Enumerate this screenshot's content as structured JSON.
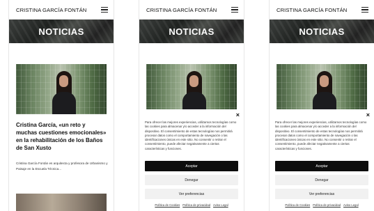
{
  "header": {
    "brand": "CRISTINA GARCÍA FONTÁN"
  },
  "hero": {
    "title": "NOTICIAS"
  },
  "article": {
    "title": "Cristina García, «un reto y muchas cuestiones emocionales» en la rehabilitación de los Baños de San Xusto",
    "excerpt": "Cristina García Fontán es arquitecta y profesora de Urbanismo y Paisaje en la Escuela Técnica..."
  },
  "cookie": {
    "close": "×",
    "text": "Para ofrecer las mejores experiencias, utilizamos tecnologías como las cookies para almacenar y/o acceder a la información del dispositivo. El consentimiento de estas tecnologías nos permitirá procesar datos como el comportamiento de navegación o las identificaciones únicas en este sitio. No consentir o retirar el consentimiento, puede afectar negativamente a ciertas características y funciones.",
    "accept": "Aceptar",
    "deny": "Denegar",
    "preferences": "Ver preferencias",
    "links": [
      "Política de Cookies",
      "Política de privacidad",
      "Aviso Legal"
    ]
  },
  "icons": {
    "menu": "hamburger-menu-icon",
    "close": "close-icon"
  },
  "colors": {
    "accept_bg": "#0d0d0d",
    "secondary_bg": "#f1f1f1",
    "hero_text": "#ffffff"
  }
}
